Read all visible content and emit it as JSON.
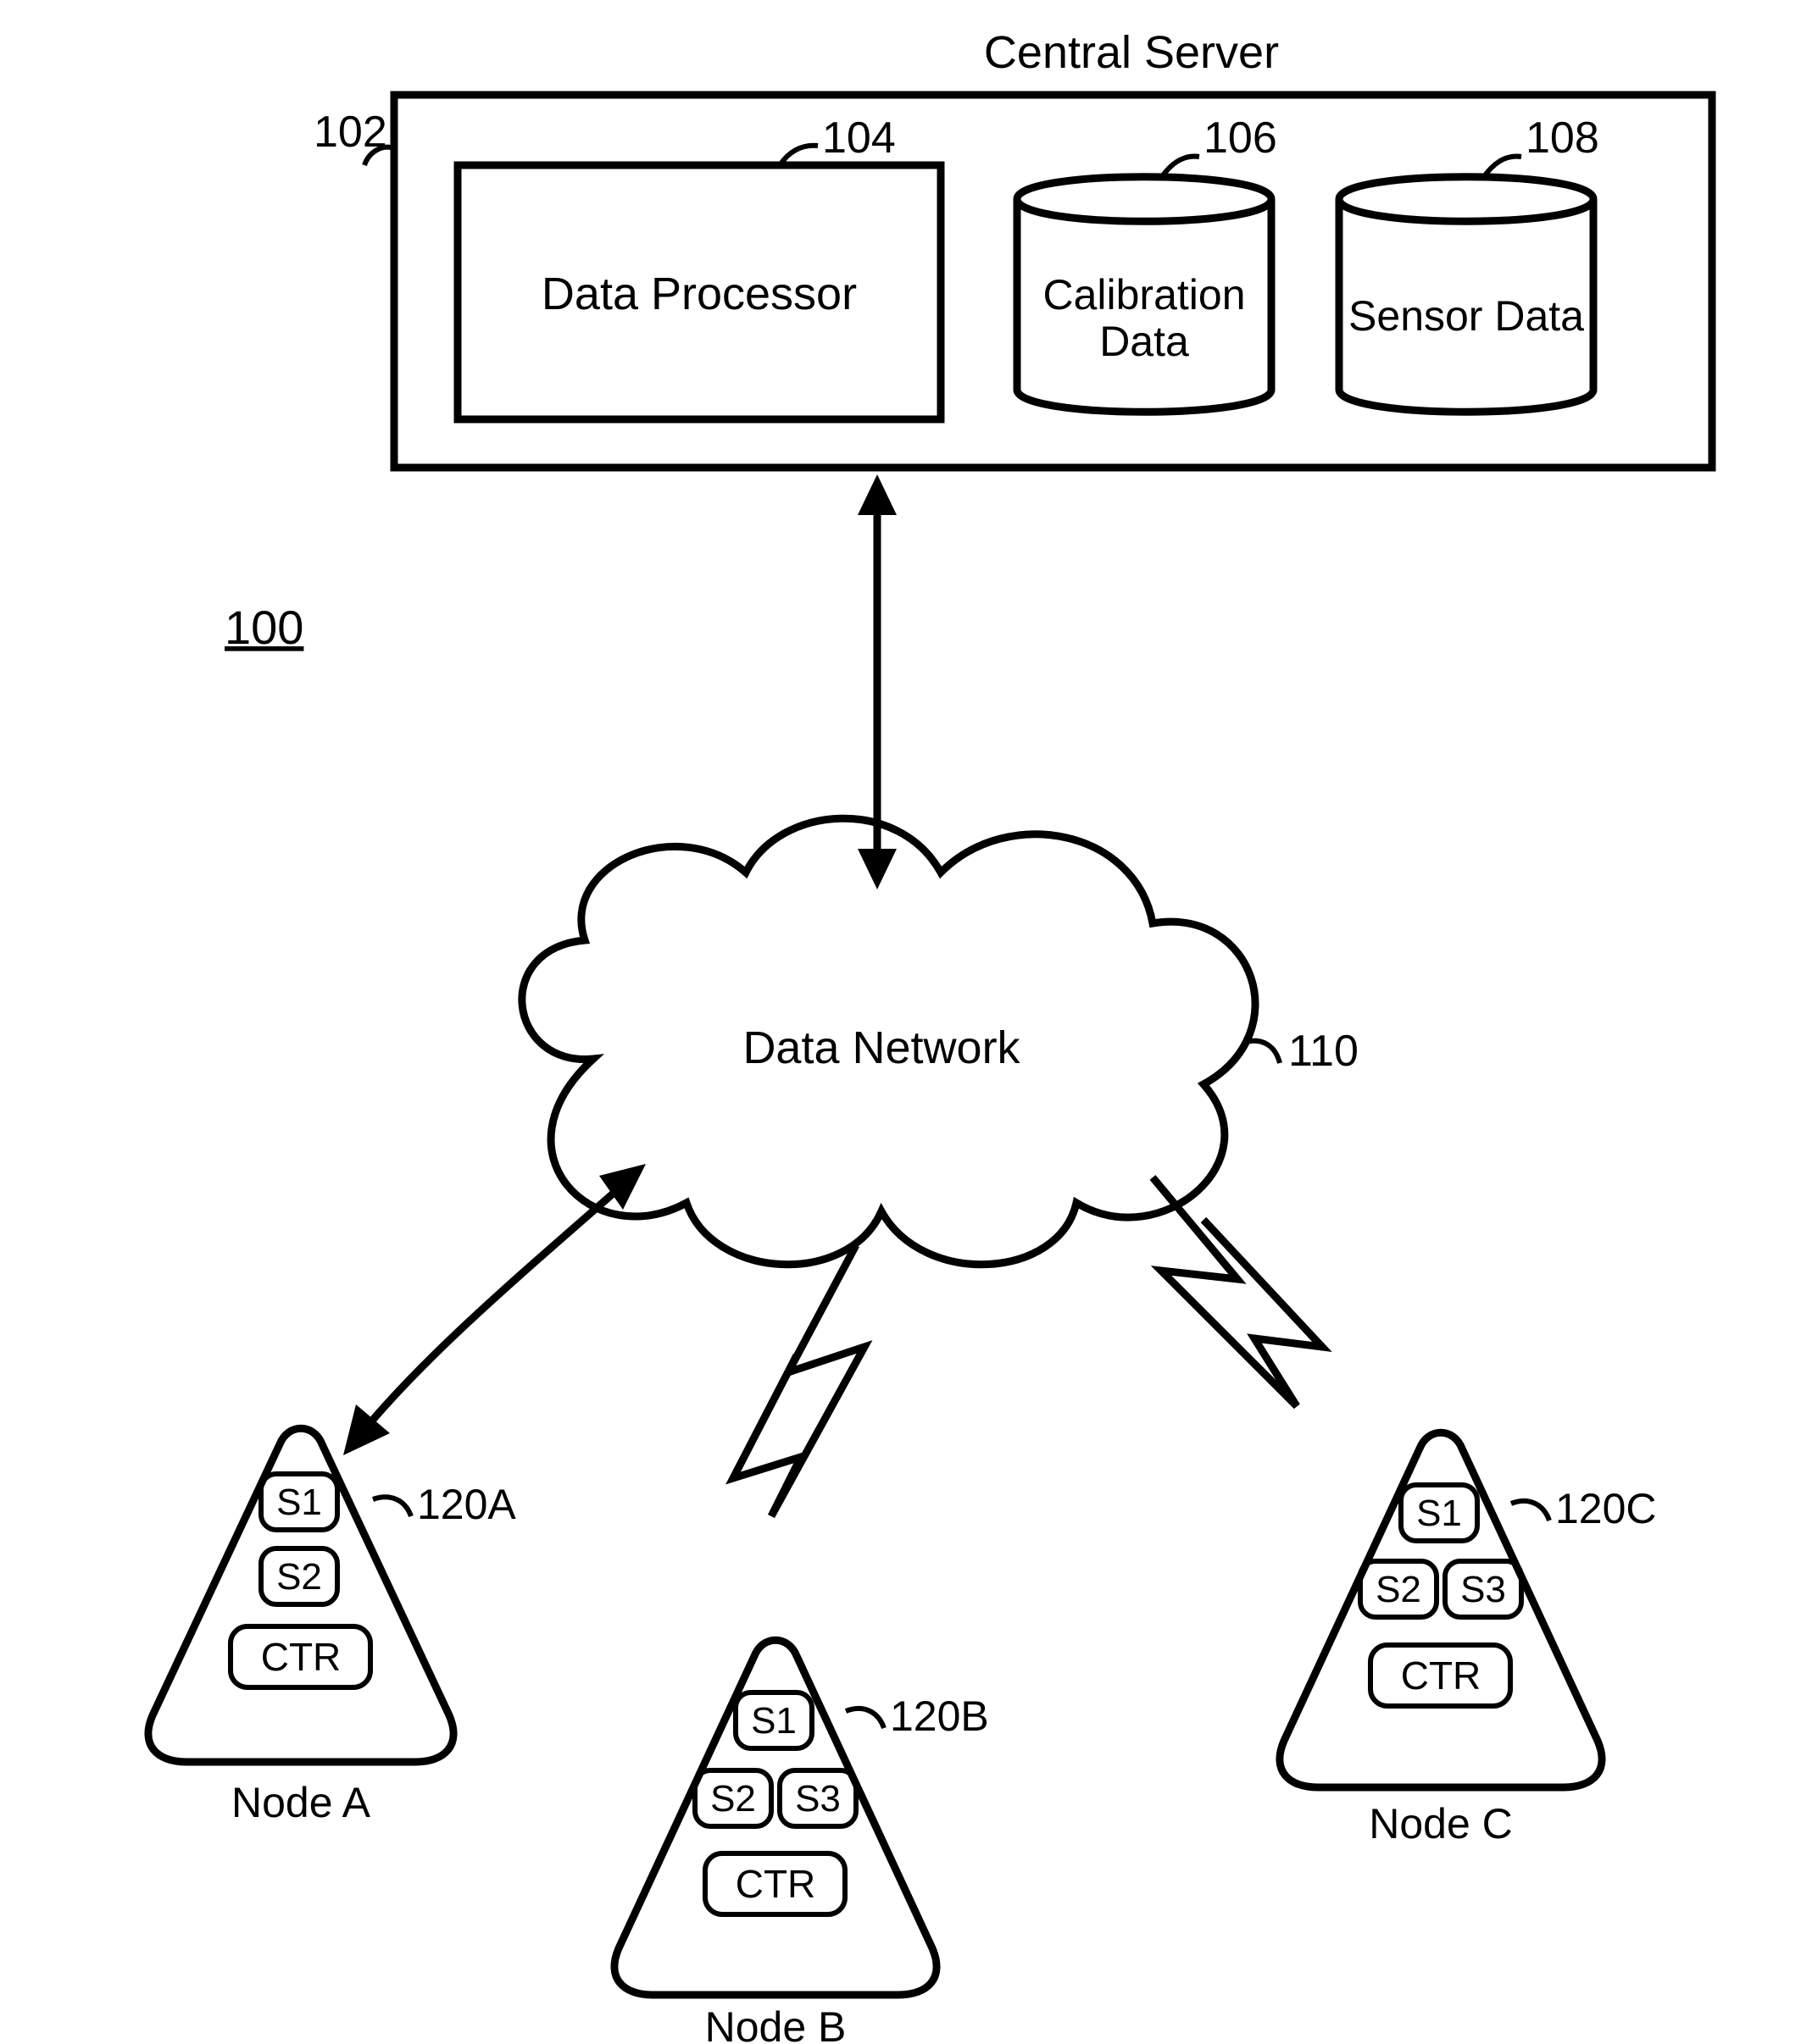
{
  "figure_ref": "100",
  "server": {
    "title": "Central Server",
    "ref": "102",
    "components": {
      "processor": {
        "label": "Data Processor",
        "ref": "104"
      },
      "calibration": {
        "label_line1": "Calibration",
        "label_line2": "Data",
        "ref": "106"
      },
      "sensordata": {
        "label": "Sensor Data",
        "ref": "108"
      }
    }
  },
  "network": {
    "label": "Data Network",
    "ref": "110"
  },
  "nodes": {
    "A": {
      "name": "Node A",
      "ref": "120A",
      "sensors": [
        "S1",
        "S2"
      ],
      "controller": "CTR"
    },
    "B": {
      "name": "Node B",
      "ref": "120B",
      "sensors": [
        "S1",
        "S2",
        "S3"
      ],
      "controller": "CTR"
    },
    "C": {
      "name": "Node C",
      "ref": "120C",
      "sensors": [
        "S1",
        "S2",
        "S3"
      ],
      "controller": "CTR"
    }
  }
}
